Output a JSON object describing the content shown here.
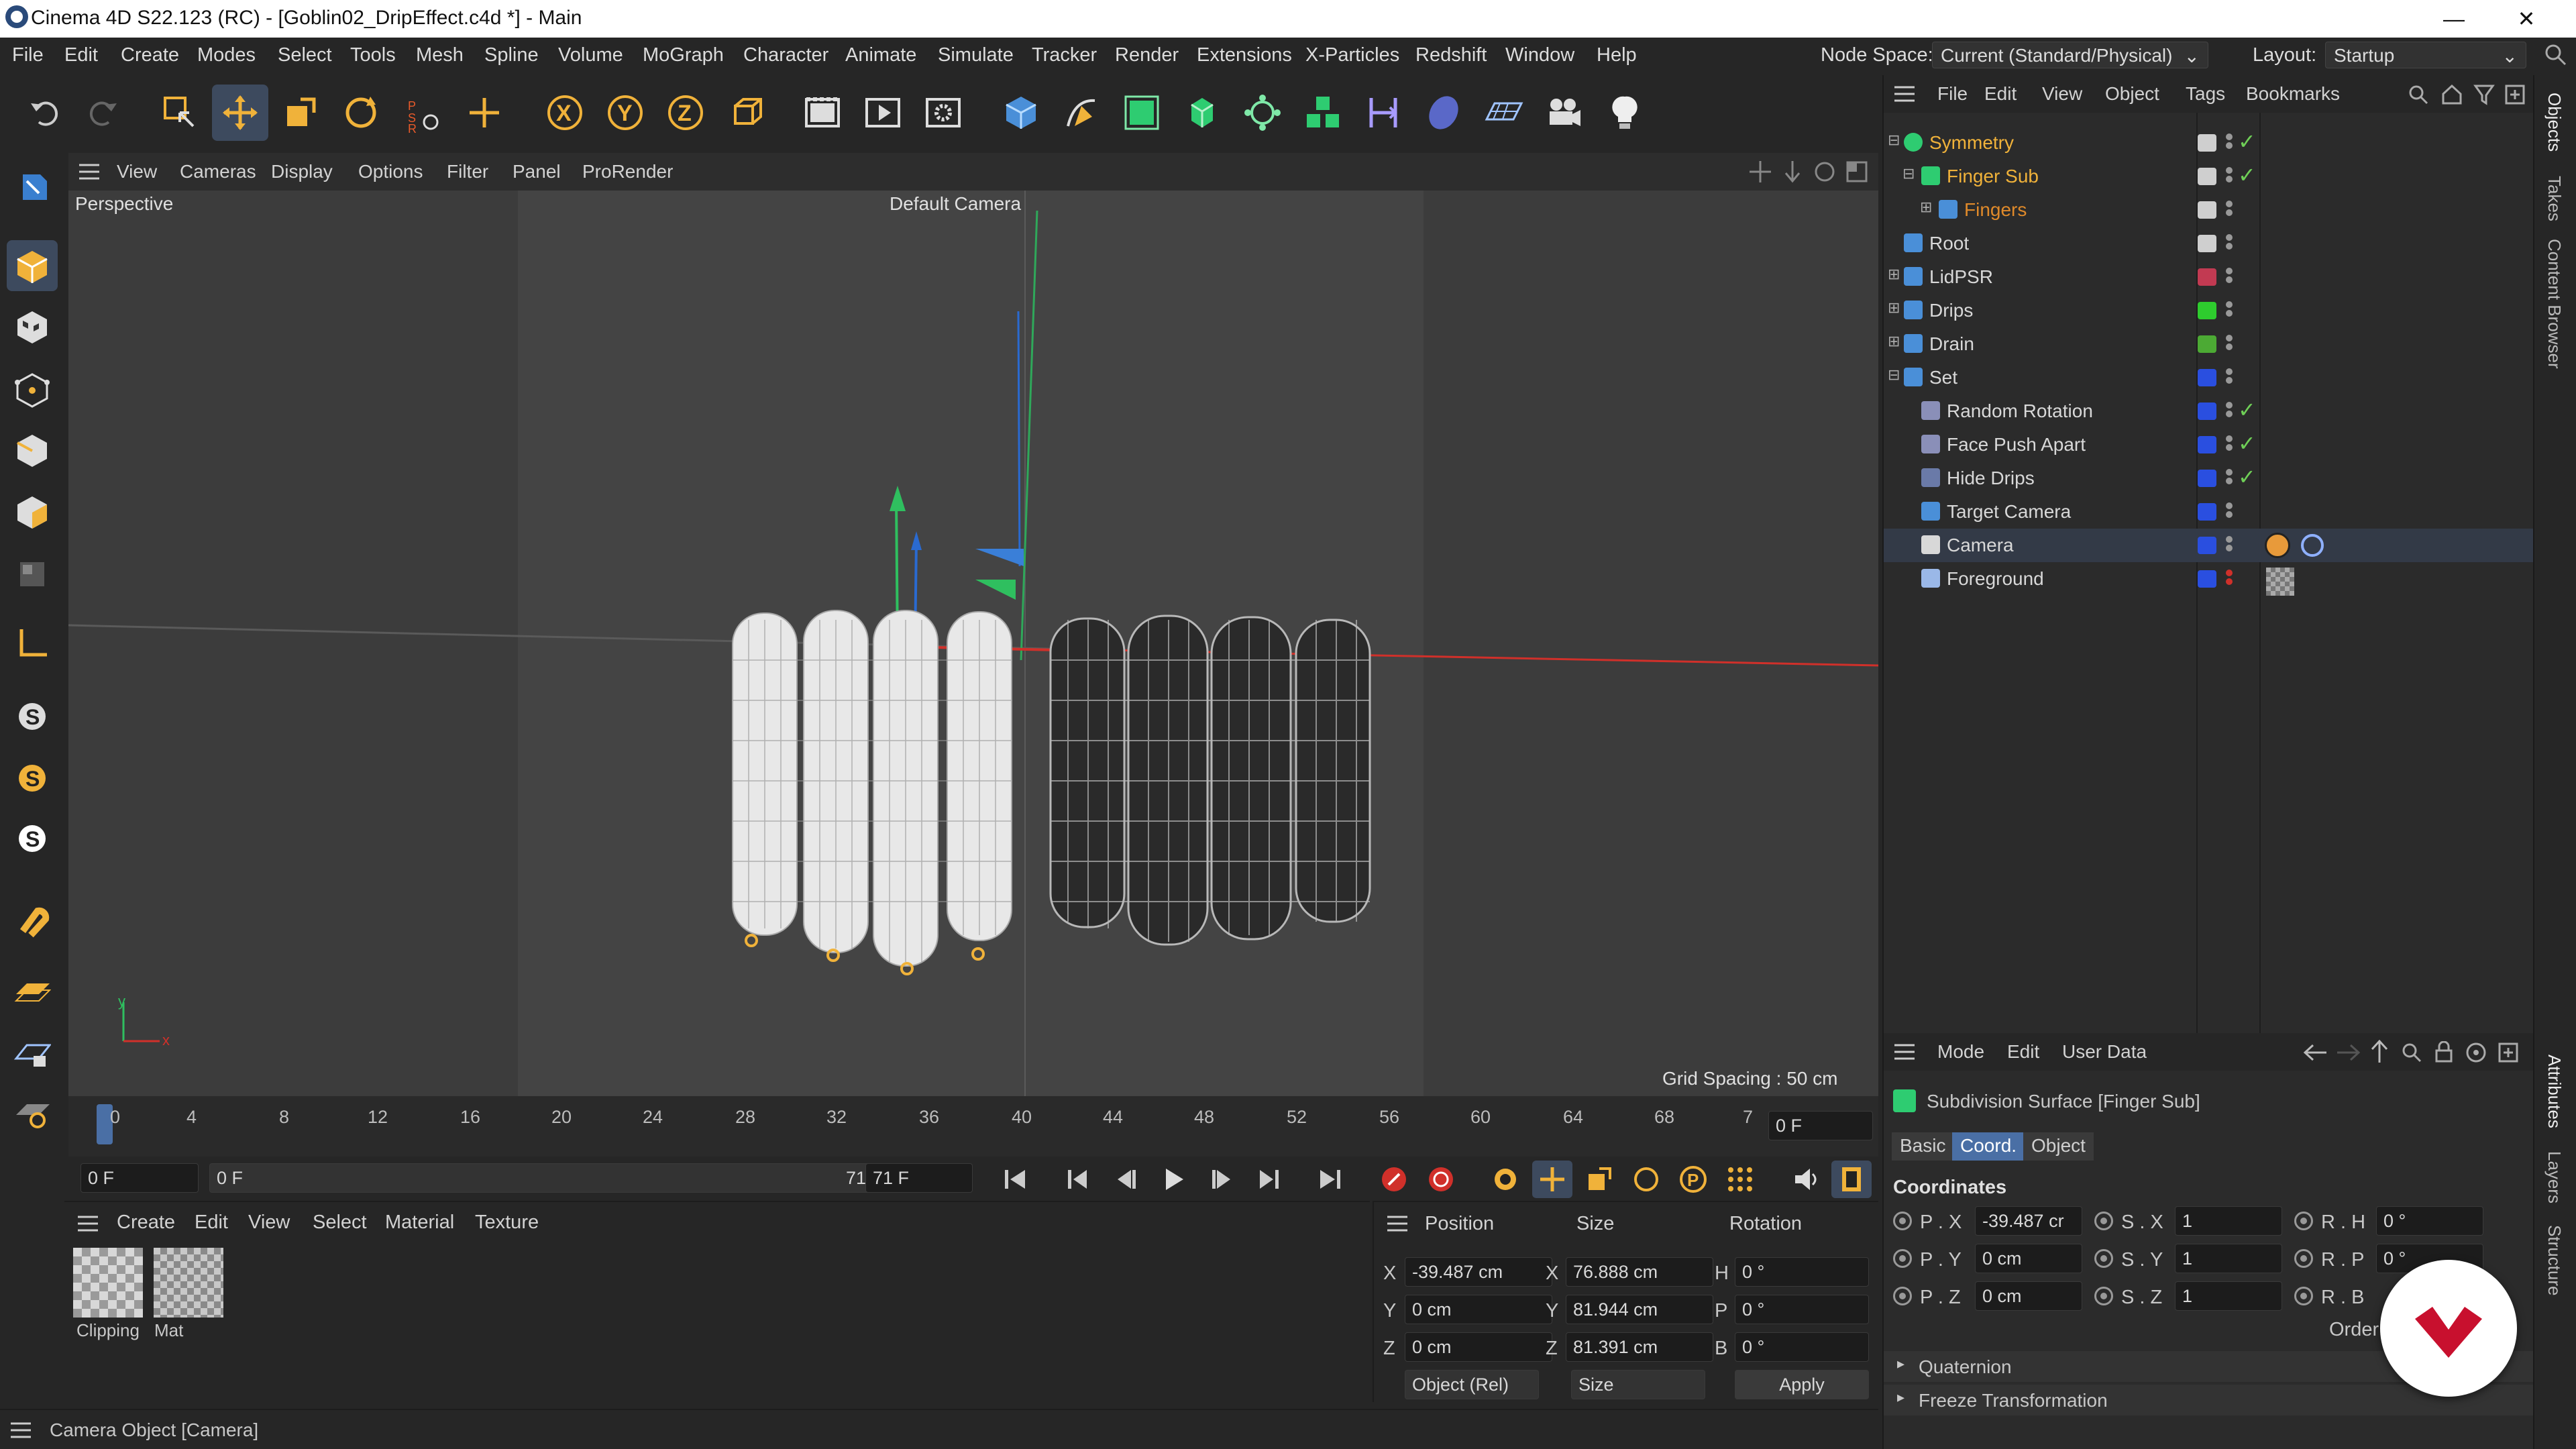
{
  "window": {
    "title": "Cinema 4D S22.123 (RC) - [Goblin02_DripEffect.c4d *] - Main",
    "min": "—",
    "max": "❐",
    "close": "✕"
  },
  "menubar": {
    "items": [
      "File",
      "Edit",
      "Create",
      "Modes",
      "Select",
      "Tools",
      "Mesh",
      "Spline",
      "Volume",
      "MoGraph",
      "Character",
      "Animate",
      "Simulate",
      "Tracker",
      "Render",
      "Extensions",
      "X-Particles",
      "Redshift",
      "Window",
      "Help"
    ],
    "node_space_label": "Node Space:",
    "node_space_value": "Current (Standard/Physical)",
    "layout_label": "Layout:",
    "layout_value": "Startup"
  },
  "viewport": {
    "menu": [
      "View",
      "Cameras",
      "Display",
      "Options",
      "Filter",
      "Panel",
      "ProRender"
    ],
    "view_name": "Perspective",
    "camera_name": "Default Camera",
    "grid_spacing": "Grid Spacing : 50 cm",
    "axis_y": "y",
    "axis_x": "x"
  },
  "timeline": {
    "ticks": [
      "0",
      "4",
      "8",
      "12",
      "16",
      "20",
      "24",
      "28",
      "32",
      "36",
      "40",
      "44",
      "48",
      "52",
      "56",
      "60",
      "64",
      "68",
      "7"
    ],
    "current_frame": "0 F"
  },
  "transport": {
    "start": "0 F",
    "range_start": "0 F",
    "range_end": "71 F",
    "end": "71 F"
  },
  "material_panel": {
    "menu": [
      "Create",
      "Edit",
      "View",
      "Select",
      "Material",
      "Texture"
    ],
    "materials": [
      {
        "name": "Clipping"
      },
      {
        "name": "Mat"
      }
    ]
  },
  "coord_panel": {
    "headers": [
      "Position",
      "Size",
      "Rotation"
    ],
    "rows": [
      {
        "axis": "X",
        "pos": "-39.487 cm",
        "saxis": "X",
        "size": "76.888 cm",
        "raxis": "H",
        "rot": "0 °"
      },
      {
        "axis": "Y",
        "pos": "0 cm",
        "saxis": "Y",
        "size": "81.944 cm",
        "raxis": "P",
        "rot": "0 °"
      },
      {
        "axis": "Z",
        "pos": "0 cm",
        "saxis": "Z",
        "size": "81.391 cm",
        "raxis": "B",
        "rot": "0 °"
      }
    ],
    "mode": "Object (Rel)",
    "size_mode": "Size",
    "apply": "Apply"
  },
  "status": {
    "text": "Camera Object [Camera]"
  },
  "objects": {
    "menu": [
      "File",
      "Edit",
      "View",
      "Object",
      "Tags",
      "Bookmarks"
    ],
    "rows": [
      {
        "name": "Symmetry",
        "color": "#f0b23a",
        "tag": "#cfcfcf",
        "check": "✓"
      },
      {
        "name": "Finger Sub",
        "color": "#f0b23a",
        "tag": "#cfcfcf",
        "check": "✓"
      },
      {
        "name": "Fingers",
        "color": "#e08a2a",
        "tag": "#cfcfcf",
        "check": ""
      },
      {
        "name": "Root",
        "color": "#d8d8d8",
        "tag": "#cfcfcf",
        "check": ""
      },
      {
        "name": "LidPSR",
        "color": "#d8d8d8",
        "tag": "#c23a52",
        "check": ""
      },
      {
        "name": "Drips",
        "color": "#d8d8d8",
        "tag": "#2ecc2e",
        "check": ""
      },
      {
        "name": "Drain",
        "color": "#d8d8d8",
        "tag": "#4caa34",
        "check": ""
      },
      {
        "name": "Set",
        "color": "#d8d8d8",
        "tag": "#2a4fe0",
        "check": ""
      },
      {
        "name": "Random Rotation",
        "color": "#d8d8d8",
        "tag": "#2a4fe0",
        "check": "✓"
      },
      {
        "name": "Face Push Apart",
        "color": "#d8d8d8",
        "tag": "#2a4fe0",
        "check": "✓"
      },
      {
        "name": "Hide Drips",
        "color": "#d8d8d8",
        "tag": "#2a4fe0",
        "check": "✓"
      },
      {
        "name": "Target Camera",
        "color": "#d8d8d8",
        "tag": "#2a4fe0",
        "check": ""
      },
      {
        "name": "Camera",
        "color": "#d8d8d8",
        "tag": "#2a4fe0",
        "check": ""
      },
      {
        "name": "Foreground",
        "color": "#d8d8d8",
        "tag": "#2a4fe0",
        "check": ""
      }
    ]
  },
  "attributes": {
    "menu": [
      "Mode",
      "Edit",
      "User Data"
    ],
    "object_title": "Subdivision Surface [Finger Sub]",
    "tabs": [
      "Basic",
      "Coord.",
      "Object"
    ],
    "section": "Coordinates",
    "rows": [
      {
        "p": "P . X",
        "pv": "-39.487 cr",
        "s": "S . X",
        "sv": "1",
        "r": "R . H",
        "rv": "0 °"
      },
      {
        "p": "P . Y",
        "pv": "0 cm",
        "s": "S . Y",
        "sv": "1",
        "r": "R . P",
        "rv": "0 °"
      },
      {
        "p": "P . Z",
        "pv": "0 cm",
        "s": "S . Z",
        "sv": "1",
        "r": "R . B",
        "rv": "0 °"
      }
    ],
    "order": "Order",
    "quaternion": "Quaternion",
    "freeze": "Freeze Transformation"
  },
  "right_tabs": [
    "Objects",
    "Takes",
    "Content Browser",
    "Attributes",
    "Layers",
    "Structure"
  ]
}
